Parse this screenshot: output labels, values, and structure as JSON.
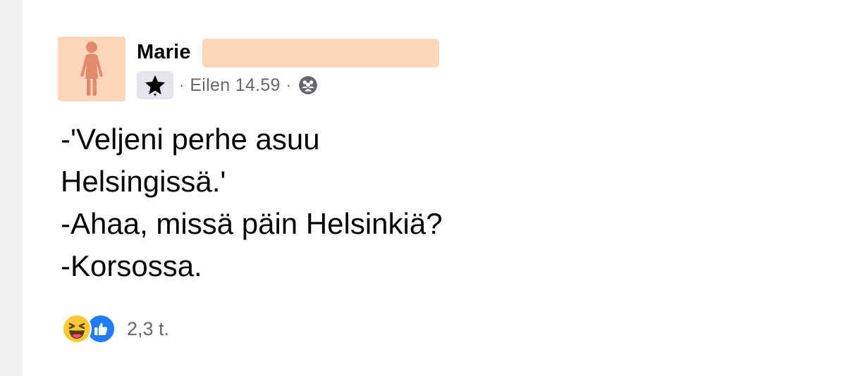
{
  "post": {
    "author_name": "Marie",
    "timestamp": "Eilen 14.59",
    "separator": "·",
    "lines": [
      "-'Veljeni perhe asuu",
      "Helsingissä.'",
      "-Ahaa, missä päin Helsinkiä?",
      "-Korsossa."
    ],
    "reaction_count": "2,3 t."
  },
  "icons": {
    "avatar": "woman-figure-icon",
    "badge": "star-badge-icon",
    "audience": "friends-audience-icon",
    "reactions": [
      "haha-reaction-icon",
      "like-reaction-icon"
    ]
  },
  "colors": {
    "avatar_bg": "#fdd7b8",
    "avatar_figure": "#e2896e",
    "redaction": "#fdd7b8",
    "meta_text": "#65676b",
    "like_blue": "#1f7cf2",
    "haha_yellow": "#fcc935"
  }
}
